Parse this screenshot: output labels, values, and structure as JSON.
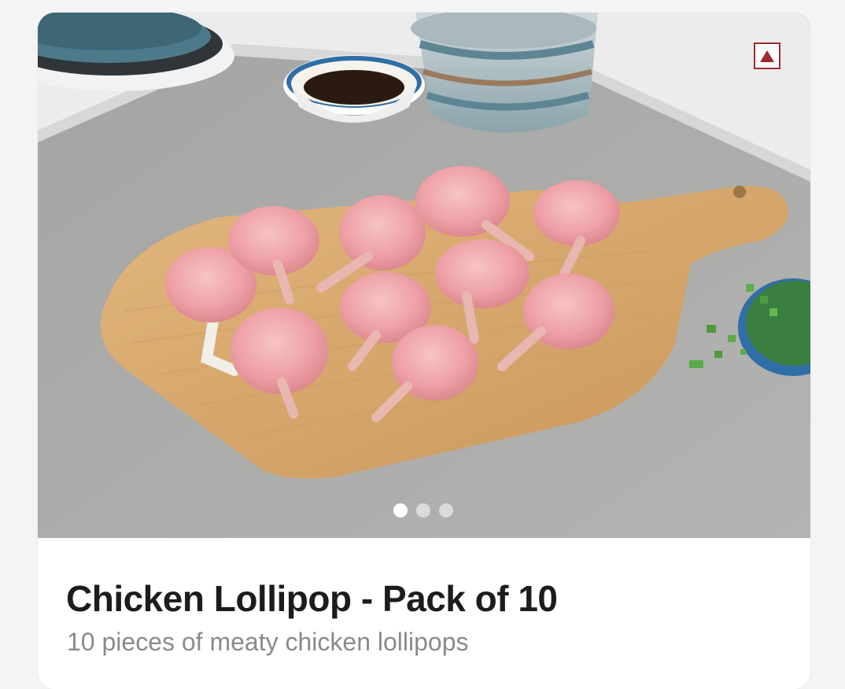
{
  "product": {
    "title": "Chicken Lollipop - Pack of 10",
    "description": "10 pieces of meaty chicken lollipops",
    "image_subject": "raw chicken lollipops on a wooden cutting board",
    "category_badge_color": "#9e2a2f",
    "category_badge_icon": "non-veg-triangle-icon"
  },
  "carousel": {
    "total_slides": 3,
    "active_slide": 1
  }
}
